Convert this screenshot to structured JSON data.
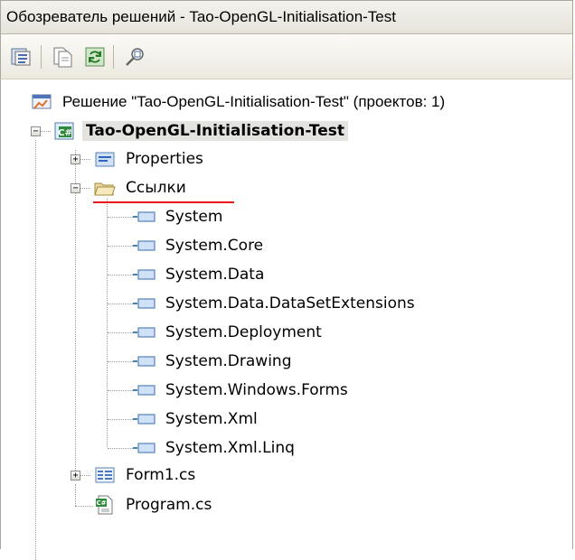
{
  "window": {
    "title": "Обозреватель решений - Tao-OpenGL-Initialisation-Test"
  },
  "toolbar": {
    "buttons": [
      {
        "icon": "properties-icon"
      },
      {
        "icon": "show-all-files-icon"
      },
      {
        "icon": "refresh-icon"
      },
      {
        "icon": "view-class-diagram-icon"
      }
    ]
  },
  "tree": {
    "solution": "Решение \"Tao-OpenGL-Initialisation-Test\" (проектов: 1)",
    "project": "Tao-OpenGL-Initialisation-Test",
    "properties": "Properties",
    "references": "Ссылки",
    "reference_items": [
      "System",
      "System.Core",
      "System.Data",
      "System.Data.DataSetExtensions",
      "System.Deployment",
      "System.Drawing",
      "System.Windows.Forms",
      "System.Xml",
      "System.Xml.Linq"
    ],
    "form": "Form1.cs",
    "program": "Program.cs"
  },
  "colors": {
    "underline": "#e8141c",
    "selection": "#e3e3df",
    "border": "#a9a89c"
  }
}
